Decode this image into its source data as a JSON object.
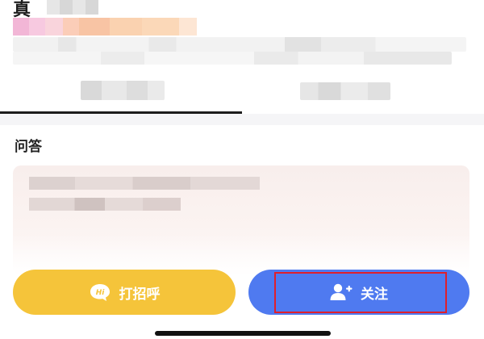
{
  "profile": {
    "name_char": "真"
  },
  "qa_section": {
    "title": "问答"
  },
  "actions": {
    "greet_label": "打招呼",
    "greet_icon_text": "Hi",
    "greet_icon": "hi-chat-bubble-icon",
    "follow_label": "关注",
    "follow_icon": "add-user-icon"
  },
  "colors": {
    "greet_button": "#f5c43a",
    "follow_button": "#4f7af0",
    "highlight_box": "#e01f2b",
    "qa_card": "#f8eeec"
  }
}
